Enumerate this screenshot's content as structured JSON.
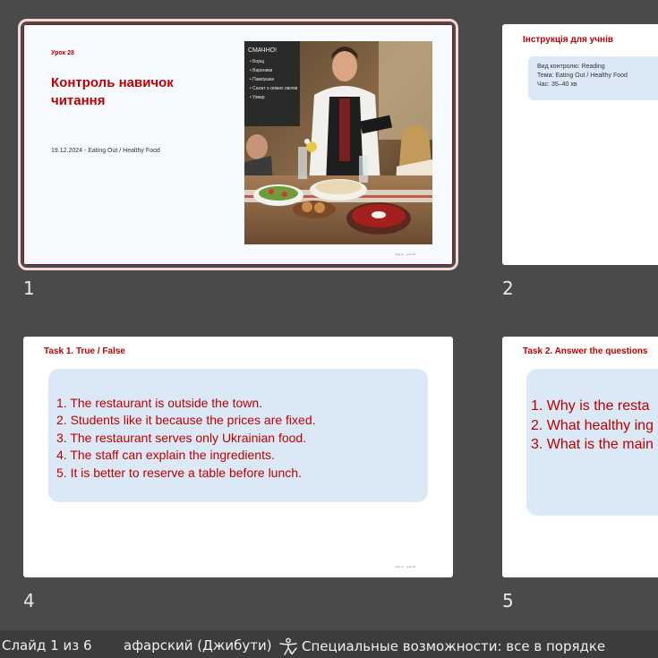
{
  "slides": [
    {
      "number": "1",
      "lesson": "Урок 28",
      "title": "Контроль навичок читання",
      "date_topic": "19.12.2024 - Eating Out / Healthy Food",
      "footer": "Eng 11 · урок 28",
      "photo_board": [
        "СМАЧНО!",
        "• Борщ",
        "• Вареники",
        "• Пампушки",
        "• Салат з свіжих овочів",
        "• Узвар"
      ]
    },
    {
      "number": "2",
      "heading": "Інструкція для учнів",
      "info": [
        "Вид контролю: Reading",
        "Тема: Eating Out / Healthy Food",
        "Час: 35–40 хв"
      ]
    },
    {
      "number": "4",
      "heading": "Task 1. True / False",
      "items": [
        "1. The restaurant is outside the town.",
        "2. Students like it because the prices are fixed.",
        "3. The restaurant serves only Ukrainian food.",
        "4. The staff can explain the ingredients.",
        "5. It is better to reserve a table before lunch."
      ],
      "footer": "Eng 11 · урок 28"
    },
    {
      "number": "5",
      "heading": "Task 2. Answer the questions",
      "items": [
        "1. Why is the resta",
        "2. What healthy ing",
        "3. What is the main"
      ]
    }
  ],
  "statusbar": {
    "slide_counter": "Слайд 1 из 6",
    "language": "афарский (Джибути)",
    "accessibility": "Специальные возможности: все в порядке"
  },
  "colors": {
    "accent_red": "#c00000",
    "box_blue": "#dbe8f5",
    "background": "#4a4a4a",
    "selection": "#f6d6d6"
  }
}
